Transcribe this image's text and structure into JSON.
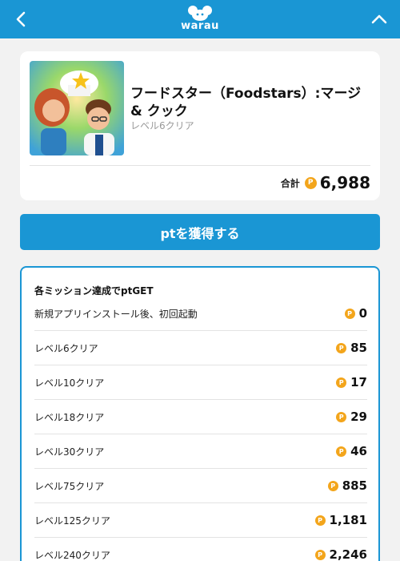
{
  "header": {
    "logo_text": "warau",
    "back_icon": "chevron-left-icon",
    "up_icon": "chevron-up-icon",
    "color": "#1a96d4"
  },
  "app": {
    "title": "フードスター（Foodstars）:マージ & クック",
    "subtitle": "レベル6クリア",
    "total_label": "合計",
    "total_value": "6,988",
    "coin_glyph": "P"
  },
  "cta": {
    "label": "ptを獲得する"
  },
  "missions": {
    "title": "各ミッション達成でptGET",
    "items": [
      {
        "label": "新規アプリインストール後、初回起動",
        "points": "0"
      },
      {
        "label": "レベル6クリア",
        "points": "85"
      },
      {
        "label": "レベル10クリア",
        "points": "17"
      },
      {
        "label": "レベル18クリア",
        "points": "29"
      },
      {
        "label": "レベル30クリア",
        "points": "46"
      },
      {
        "label": "レベル75クリア",
        "points": "885"
      },
      {
        "label": "レベル125クリア",
        "points": "1,181"
      },
      {
        "label": "レベル240クリア",
        "points": "2,246"
      }
    ]
  },
  "colors": {
    "accent": "#1a96d4",
    "coin": "#f3a51b"
  }
}
